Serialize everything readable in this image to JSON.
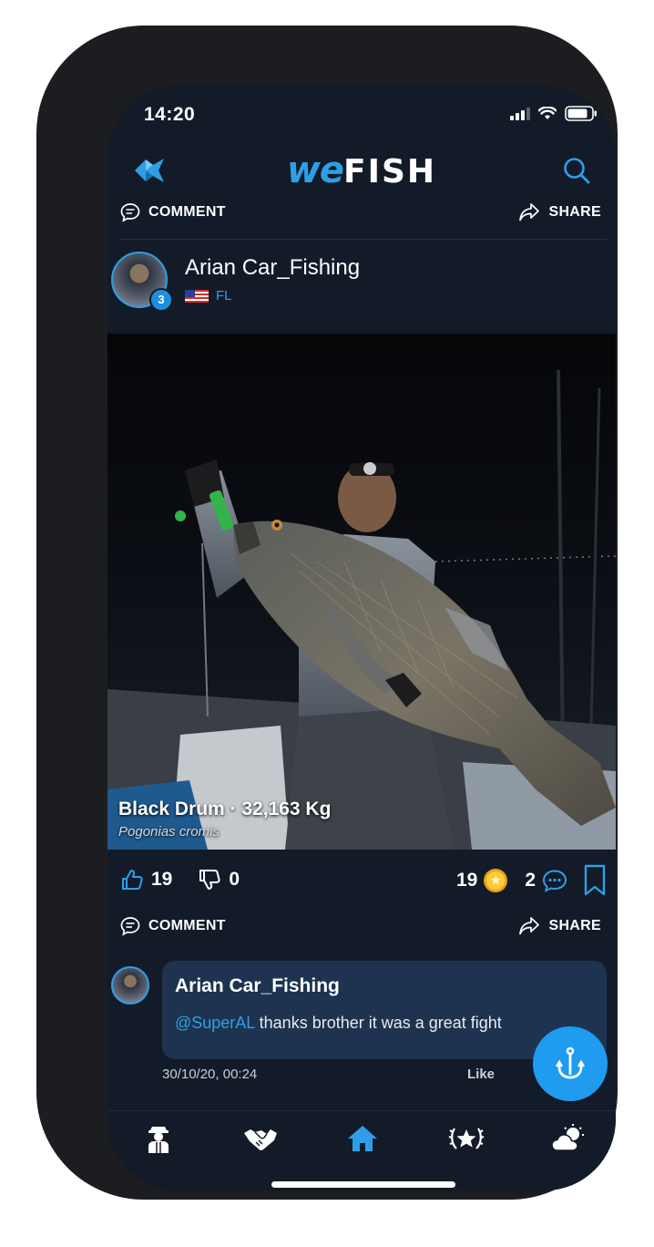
{
  "status_bar": {
    "time": "14:20"
  },
  "header": {
    "app_name_part1": "we",
    "app_name_part2": "FISH"
  },
  "top_actions": {
    "comment_label": "COMMENT",
    "share_label": "SHARE"
  },
  "post": {
    "username": "Arian Car_Fishing",
    "user_badge": "3",
    "location": "FL",
    "catch_title": "Black Drum · 32,163 Kg",
    "species": "Pogonias cromis",
    "likes": "19",
    "dislikes": "0",
    "coins": "19",
    "comments": "2",
    "comment_label": "COMMENT",
    "share_label": "SHARE"
  },
  "comment": {
    "username": "Arian Car_Fishing",
    "mention": "@SuperAL",
    "text": " thanks brother it was a great fight",
    "timestamp": "30/10/20, 00:24",
    "like_label": "Like"
  },
  "nav": {
    "items": [
      "profile-icon",
      "handshake-icon",
      "home-icon",
      "star-award-icon",
      "weather-icon"
    ],
    "active": "home-icon"
  },
  "colors": {
    "accent": "#2e9fe6",
    "background": "#131b29",
    "bubble": "#1d3350",
    "fab": "#1f9bf0"
  }
}
